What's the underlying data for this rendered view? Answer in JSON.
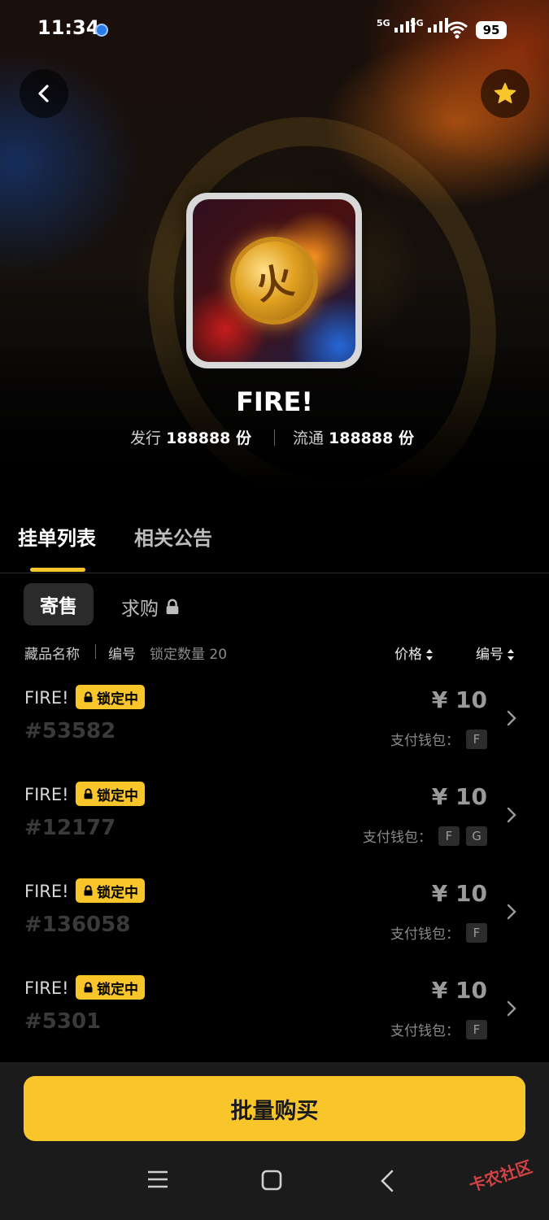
{
  "status_bar": {
    "time": "11:34",
    "battery": "95",
    "signal_1": "5G",
    "signal_2": "5G"
  },
  "collection": {
    "title": "FIRE!",
    "coin_char": "火",
    "issued_label": "发行",
    "issued_value": "188888 份",
    "circulation_label": "流通",
    "circulation_value": "188888 份"
  },
  "tabs": [
    {
      "label": "挂单列表",
      "active": true
    },
    {
      "label": "相关公告",
      "active": false
    }
  ],
  "sub_tabs": [
    {
      "label": "寄售",
      "active": true
    },
    {
      "label": "求购",
      "locked": true
    }
  ],
  "list_header": {
    "name": "藏品名称",
    "number": "编号",
    "lock_count": "锁定数量 20",
    "price": "价格",
    "sort_number": "编号"
  },
  "listings": [
    {
      "name": "FIRE!",
      "badge": "锁定中",
      "id": "#53582",
      "price": "¥ 10",
      "wallet_label": "支付钱包：",
      "wallets": [
        "F"
      ]
    },
    {
      "name": "FIRE!",
      "badge": "锁定中",
      "id": "#12177",
      "price": "¥ 10",
      "wallet_label": "支付钱包：",
      "wallets": [
        "F",
        "G"
      ]
    },
    {
      "name": "FIRE!",
      "badge": "锁定中",
      "id": "#136058",
      "price": "¥ 10",
      "wallet_label": "支付钱包：",
      "wallets": [
        "F"
      ]
    },
    {
      "name": "FIRE!",
      "badge": "锁定中",
      "id": "#5301",
      "price": "¥ 10",
      "wallet_label": "支付钱包：",
      "wallets": [
        "F"
      ]
    }
  ],
  "buy_button": "批量购买",
  "watermark": "卡农社区",
  "colors": {
    "accent": "#f8c52b",
    "background": "#000000",
    "bottom_bar": "#1b1b1b"
  },
  "icons": {
    "back": "chevron-left-icon",
    "favorite": "star-icon",
    "lock": "lock-icon",
    "sort": "sort-icon",
    "row": "chevron-right-icon"
  }
}
